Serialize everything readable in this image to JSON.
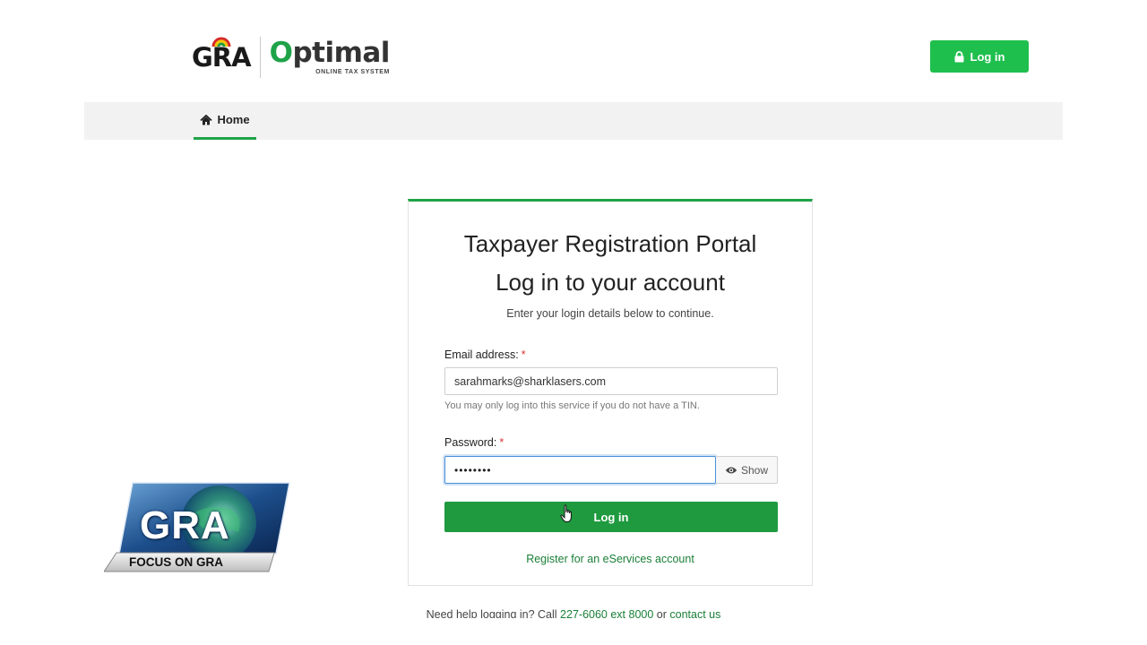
{
  "header": {
    "logo_gra": "GRA",
    "logo_optimal": "Optimal",
    "logo_optimal_subtitle": "ONLINE TAX SYSTEM",
    "login_button_label": "Log in"
  },
  "nav": {
    "home_label": "Home"
  },
  "login_card": {
    "title": "Taxpayer Registration Portal",
    "heading": "Log in to your account",
    "subtitle": "Enter your login details below to continue.",
    "email_label": "Email address:",
    "email_required_mark": "*",
    "email_value": "sarahmarks@sharklasers.com",
    "email_help": "You may only log into this service if you do not have a TIN.",
    "password_label": "Password:",
    "password_required_mark": "*",
    "password_value": "••••••••",
    "show_label": "Show",
    "submit_label": "Log in",
    "register_link": "Register for an eServices account"
  },
  "footer": {
    "help_prefix": "Need help logging in? Call ",
    "help_phone": "227-6060 ext 8000",
    "help_or": " or ",
    "help_contact": "contact us"
  },
  "overlay": {
    "channel_logo_text": "GRA",
    "channel_caption": "FOCUS ON GRA"
  },
  "colors": {
    "brand_green": "#1fa348",
    "button_green": "#1f9a3f",
    "header_button_green": "#1fbf4d",
    "focus_blue": "#4a90d9"
  },
  "icons": {
    "header_button": "lock-icon",
    "nav_home": "home-icon",
    "password_toggle": "eye-icon",
    "pointer": "hand-cursor-icon"
  }
}
